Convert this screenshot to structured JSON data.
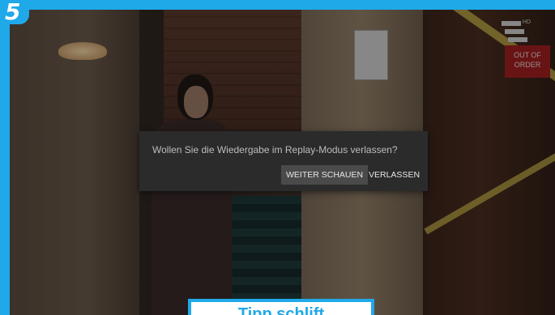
{
  "step": {
    "number": "5"
  },
  "channel_logo": {
    "name": "prosieben-logo-icon",
    "quality": "HD"
  },
  "scene_sign": {
    "text": "OUT OF ORDER"
  },
  "dialog": {
    "message": "Wollen Sie die Wiedergabe im Replay-Modus verlassen?",
    "continue_label": "WEITER SCHAUEN",
    "leave_label": "VERLASSEN"
  },
  "caption": {
    "text": "Tipp schlift"
  },
  "colors": {
    "accent": "#1fa9e8",
    "dialog_bg": "#2b2b2b",
    "button_selected": "#4a4a4a"
  }
}
